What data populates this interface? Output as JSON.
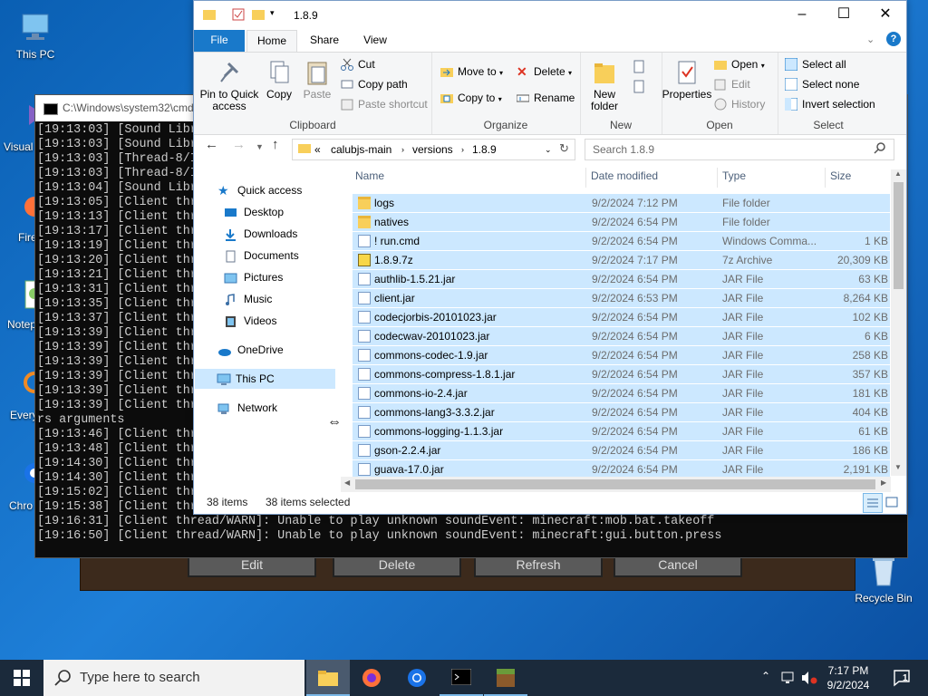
{
  "desktop": {
    "icons": [
      {
        "label": "This PC"
      },
      {
        "label": "Visual"
      },
      {
        "label": "Fire"
      },
      {
        "label": "Notep"
      },
      {
        "label": "Everys"
      },
      {
        "label": "Chro"
      },
      {
        "label": "Recycle Bin"
      }
    ]
  },
  "minecraft": {
    "buttons": [
      "Edit",
      "Delete",
      "Refresh",
      "Cancel"
    ]
  },
  "cmd": {
    "title": "C:\\Windows\\system32\\cmd",
    "lines": [
      "[19:13:03] [Sound Libr",
      "[19:13:03] [Sound Libr",
      "[19:13:03] [Thread-8/I",
      "[19:13:03] [Thread-8/I",
      "[19:13:04] [Sound Libr",
      "[19:13:05] [Client thr",
      "[19:13:13] [Client thr",
      "[19:13:17] [Client thr",
      "[19:13:19] [Client thr",
      "[19:13:20] [Client thr",
      "[19:13:21] [Client thr",
      "[19:13:31] [Client thr",
      "[19:13:35] [Client thr",
      "[19:13:37] [Client thr",
      "[19:13:39] [Client thr",
      "[19:13:39] [Client thr",
      "[19:13:39] [Client thr",
      "[19:13:39] [Client thr",
      "[19:13:39] [Client thr",
      "[19:13:39] [Client thr",
      "rs arguments",
      "[19:13:46] [Client thr",
      "[19:13:48] [Client thr",
      "[19:14:30] [Client thr",
      "[19:14:30] [Client thr",
      "[19:15:02] [Client thr",
      "[19:15:38] [Client thr",
      "[19:16:31] [Client thread/WARN]: Unable to play unknown soundEvent: minecraft:mob.bat.takeoff",
      "[19:16:50] [Client thread/WARN]: Unable to play unknown soundEvent: minecraft:gui.button.press"
    ]
  },
  "explorer": {
    "title": "1.8.9",
    "tabs": [
      "File",
      "Home",
      "Share",
      "View"
    ],
    "ribbon": {
      "clipboard": {
        "label": "Clipboard",
        "pin": "Pin to Quick access",
        "copy": "Copy",
        "paste": "Paste",
        "cut": "Cut",
        "copy_path": "Copy path",
        "paste_shortcut": "Paste shortcut"
      },
      "organize": {
        "label": "Organize",
        "move_to": "Move to",
        "copy_to": "Copy to",
        "delete": "Delete",
        "rename": "Rename"
      },
      "new": {
        "label": "New",
        "new_folder": "New folder"
      },
      "open": {
        "label": "Open",
        "properties": "Properties",
        "open": "Open",
        "edit": "Edit",
        "history": "History"
      },
      "select": {
        "label": "Select",
        "select_all": "Select all",
        "select_none": "Select none",
        "invert": "Invert selection"
      }
    },
    "address": {
      "prefix": "«",
      "crumbs": [
        "calubjs-main",
        "versions",
        "1.8.9"
      ]
    },
    "search_placeholder": "Search 1.8.9",
    "nav": {
      "quick_access": "Quick access",
      "items": [
        "Desktop",
        "Downloads",
        "Documents",
        "Pictures",
        "Music",
        "Videos"
      ],
      "onedrive": "OneDrive",
      "this_pc": "This PC",
      "network": "Network"
    },
    "columns": [
      "Name",
      "Date modified",
      "Type",
      "Size"
    ],
    "files": [
      {
        "name": "logs",
        "date": "9/2/2024 7:12 PM",
        "type": "File folder",
        "size": "",
        "kind": "folder"
      },
      {
        "name": "natives",
        "date": "9/2/2024 6:54 PM",
        "type": "File folder",
        "size": "",
        "kind": "folder"
      },
      {
        "name": "! run.cmd",
        "date": "9/2/2024 6:54 PM",
        "type": "Windows Comma...",
        "size": "1 KB",
        "kind": "doc"
      },
      {
        "name": "1.8.9.7z",
        "date": "9/2/2024 7:17 PM",
        "type": "7z Archive",
        "size": "20,309 KB",
        "kind": "arch"
      },
      {
        "name": "authlib-1.5.21.jar",
        "date": "9/2/2024 6:54 PM",
        "type": "JAR File",
        "size": "63 KB",
        "kind": "doc"
      },
      {
        "name": "client.jar",
        "date": "9/2/2024 6:53 PM",
        "type": "JAR File",
        "size": "8,264 KB",
        "kind": "doc"
      },
      {
        "name": "codecjorbis-20101023.jar",
        "date": "9/2/2024 6:54 PM",
        "type": "JAR File",
        "size": "102 KB",
        "kind": "doc"
      },
      {
        "name": "codecwav-20101023.jar",
        "date": "9/2/2024 6:54 PM",
        "type": "JAR File",
        "size": "6 KB",
        "kind": "doc"
      },
      {
        "name": "commons-codec-1.9.jar",
        "date": "9/2/2024 6:54 PM",
        "type": "JAR File",
        "size": "258 KB",
        "kind": "doc"
      },
      {
        "name": "commons-compress-1.8.1.jar",
        "date": "9/2/2024 6:54 PM",
        "type": "JAR File",
        "size": "357 KB",
        "kind": "doc"
      },
      {
        "name": "commons-io-2.4.jar",
        "date": "9/2/2024 6:54 PM",
        "type": "JAR File",
        "size": "181 KB",
        "kind": "doc"
      },
      {
        "name": "commons-lang3-3.3.2.jar",
        "date": "9/2/2024 6:54 PM",
        "type": "JAR File",
        "size": "404 KB",
        "kind": "doc"
      },
      {
        "name": "commons-logging-1.1.3.jar",
        "date": "9/2/2024 6:54 PM",
        "type": "JAR File",
        "size": "61 KB",
        "kind": "doc"
      },
      {
        "name": "gson-2.2.4.jar",
        "date": "9/2/2024 6:54 PM",
        "type": "JAR File",
        "size": "186 KB",
        "kind": "doc"
      },
      {
        "name": "guava-17.0.jar",
        "date": "9/2/2024 6:54 PM",
        "type": "JAR File",
        "size": "2,191 KB",
        "kind": "doc"
      }
    ],
    "status": {
      "count": "38 items",
      "selected": "38 items selected"
    }
  },
  "taskbar": {
    "search_placeholder": "Type here to search",
    "time": "7:17 PM",
    "date": "9/2/2024",
    "notifications": "1"
  },
  "colors": {
    "accent": "#1979ca",
    "selection": "#cce8ff",
    "taskbar": "#1b2a3b"
  }
}
